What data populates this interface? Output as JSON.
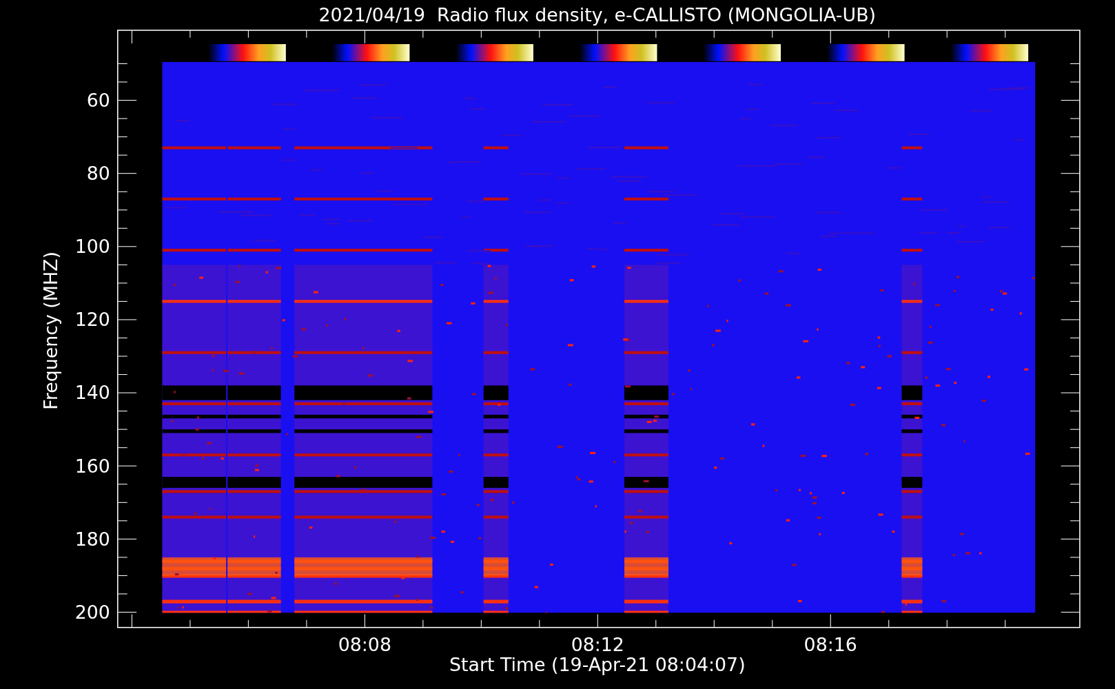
{
  "title": "2021/04/19  Radio flux density, e-CALLISTO (MONGOLIA-UB)",
  "y_axis": {
    "label": "Frequency (MHZ)",
    "ticks": [
      "60",
      "80",
      "100",
      "120",
      "140",
      "160",
      "180",
      "200"
    ]
  },
  "x_axis": {
    "label": "Start Time (19-Apr-21 08:04:07)",
    "ticks": [
      "08:08",
      "08:12",
      "08:16"
    ]
  }
}
